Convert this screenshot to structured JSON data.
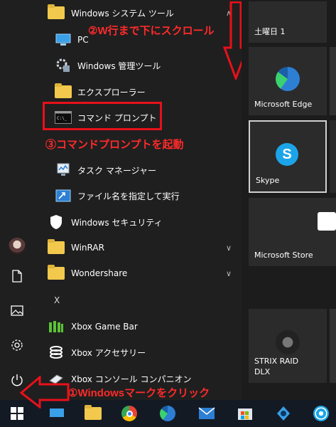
{
  "applist": {
    "group_windows_system": "Windows システム ツール",
    "pc": "PC",
    "windows_admin": "Windows 管理ツール",
    "explorer": "エクスプローラー",
    "cmd": "コマンド プロンプト",
    "taskmgr": "タスク マネージャー",
    "run": "ファイル名を指定して実行",
    "security": "Windows セキュリティ",
    "winrar": "WinRAR",
    "wondershare": "Wondershare",
    "letter_x": "X",
    "xbox_game_bar": "Xbox Game Bar",
    "xbox_accessories": "Xbox アクセサリー",
    "xbox_console": "Xbox コンソール コンパニオン"
  },
  "tiles": {
    "calendar": "土曜日 1",
    "edge": "Microsoft Edge",
    "skype": "Skype",
    "store": "Microsoft Store",
    "strix": "STRIX RAID\nDLX"
  },
  "annotations": {
    "step1": "①Windowsマークをクリック",
    "step2": "②W行まで下にスクロール",
    "step3": "③コマンドプロンプトを起動"
  },
  "colors": {
    "annotation_red": "#ff2a2a",
    "edge_blue": "#2d7fd4",
    "skype_blue": "#1ba5e8",
    "folder_yellow": "#f2c94c",
    "taskbar_bg": "#141a24"
  },
  "icons": [
    "user-avatar-icon",
    "document-icon",
    "pictures-icon",
    "settings-icon",
    "power-icon",
    "windows-start-icon",
    "chrome-icon",
    "edge-icon",
    "mail-icon",
    "store-icon",
    "file-explorer-icon"
  ]
}
